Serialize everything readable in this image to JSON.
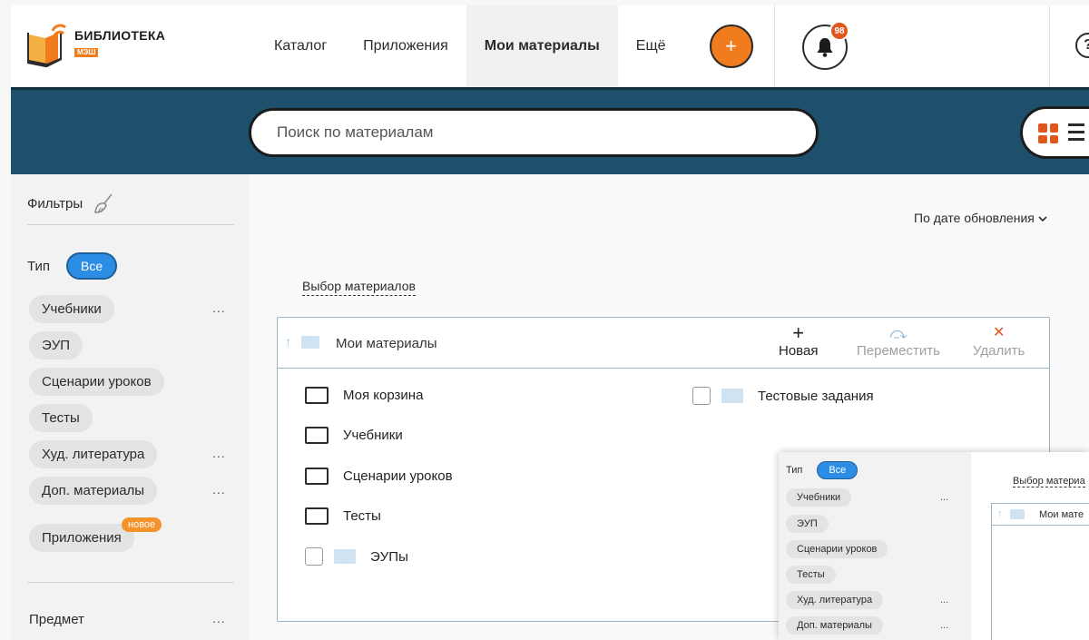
{
  "header": {
    "logo_title": "БИБЛИОТЕКА",
    "logo_sub": "МЭШ",
    "nav": [
      {
        "label": "Каталог"
      },
      {
        "label": "Приложения"
      },
      {
        "label": "Мои материалы",
        "active": true
      },
      {
        "label": "Ещё"
      }
    ],
    "add_label": "+",
    "notifications_count": "98",
    "help_label": "?"
  },
  "search": {
    "placeholder": "Поиск по материалам"
  },
  "sidebar": {
    "filters_label": "Фильтры",
    "type_label": "Тип",
    "all_label": "Все",
    "tags": [
      {
        "label": "Учебники",
        "menu": "..."
      },
      {
        "label": "ЭУП"
      },
      {
        "label": "Сценарии уроков"
      },
      {
        "label": "Тесты"
      },
      {
        "label": "Худ. литература",
        "menu": "..."
      },
      {
        "label": "Доп. материалы",
        "menu": "..."
      },
      {
        "label": "Приложения"
      }
    ],
    "new_badge": "новое",
    "subject_label": "Предмет",
    "subject_menu": "..."
  },
  "main": {
    "sort_label": "По дате обновления",
    "select_link": "Выбор материалов",
    "panel": {
      "title": "Мои материалы",
      "actions": {
        "new": "Новая",
        "move": "Переместить",
        "delete": "Удалить"
      },
      "folders_left": [
        "Моя корзина",
        "Учебники",
        "Сценарии уроков",
        "Тесты"
      ],
      "check_items": [
        "ЭУПы",
        "Тестовые задания"
      ]
    }
  },
  "overlay": {
    "type_label": "Тип",
    "all_label": "Все",
    "tags": [
      "Учебники",
      "ЭУП",
      "Сценарии уроков",
      "Тесты",
      "Худ. литература",
      "Доп. материалы"
    ],
    "menu": "...",
    "select_link": "Выбор материа",
    "panel_title": "Мои мате"
  },
  "colors": {
    "accent": "#f07c1e",
    "brand_blue": "#1e4f6b",
    "pill_blue": "#2b8de3",
    "danger": "#e0571e"
  }
}
